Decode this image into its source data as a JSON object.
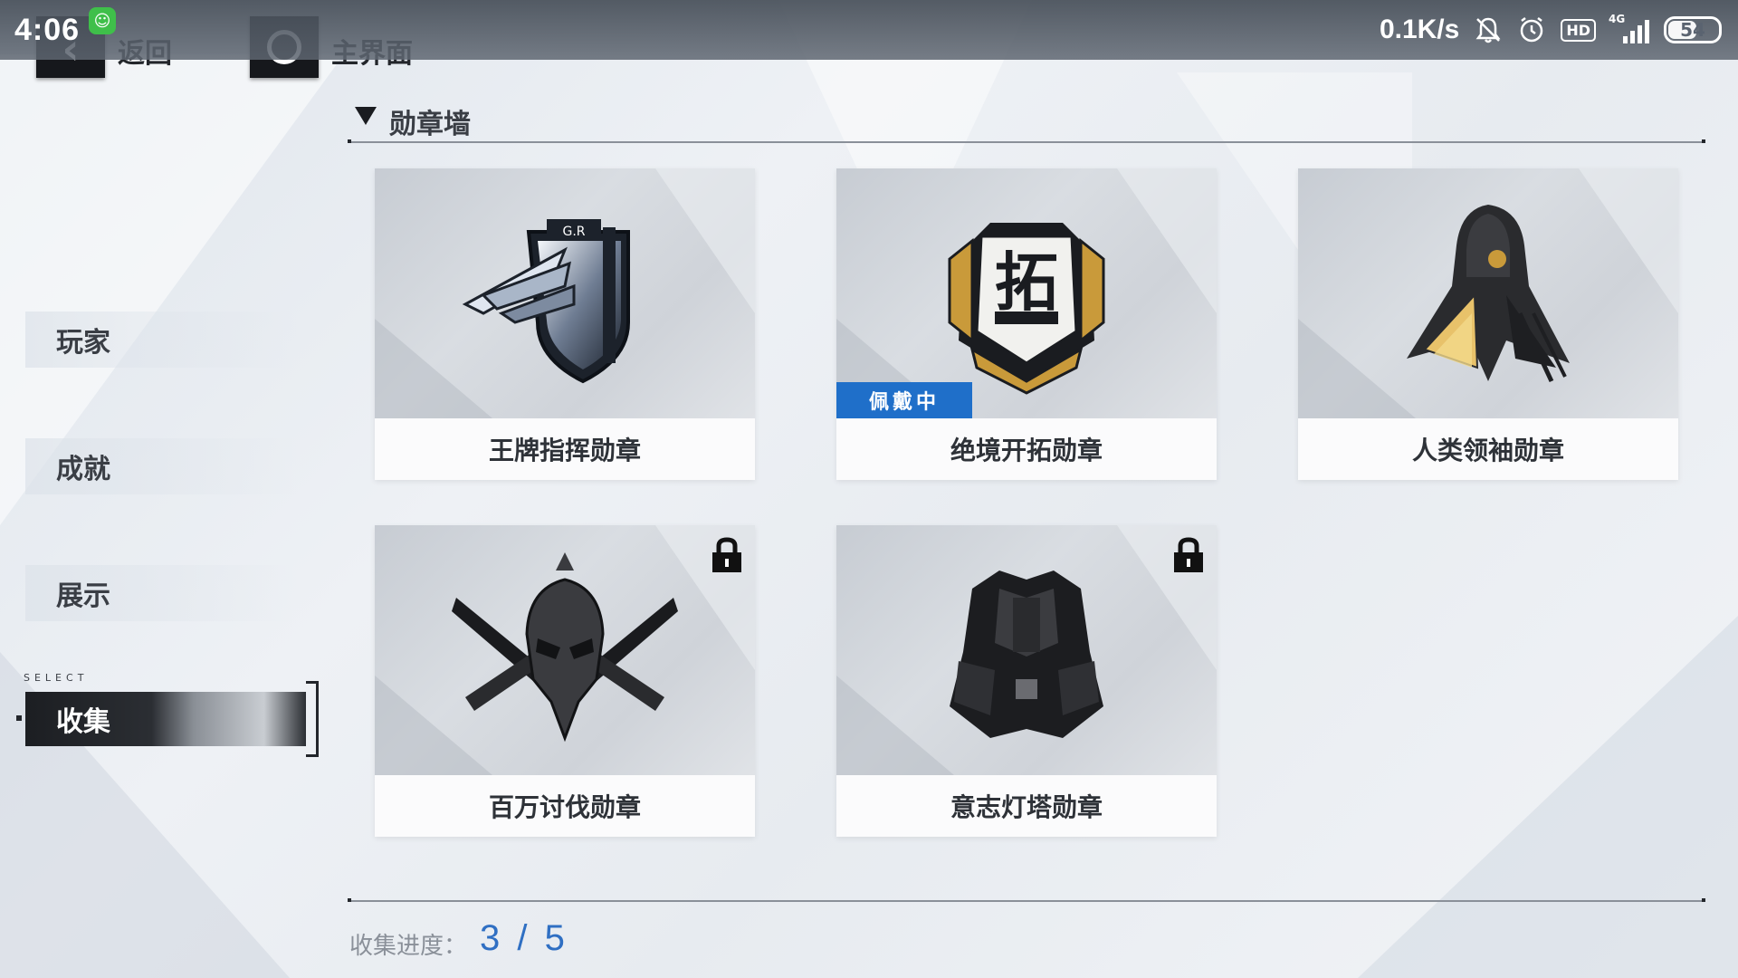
{
  "status_bar": {
    "time": "4:06",
    "net_speed": "0.1K/s",
    "hd_label": "HD",
    "network_label": "4G",
    "battery": "54",
    "battery_level": 0.54
  },
  "nav": {
    "back_label": "返回",
    "home_label": "主界面"
  },
  "sidebar": {
    "items": [
      {
        "label": "玩家"
      },
      {
        "label": "成就"
      },
      {
        "label": "展示"
      }
    ],
    "select_tag": "SELECT",
    "active": {
      "label": "收集"
    }
  },
  "section": {
    "title": "勋章墙"
  },
  "medals": [
    {
      "name": "王牌指挥勋章",
      "locked": false,
      "equipped": false,
      "icon": "wing-shield-medal-icon"
    },
    {
      "name": "绝境开拓勋章",
      "locked": false,
      "equipped": true,
      "equipped_label": "佩戴中",
      "icon": "gold-frame-medal-icon",
      "emblem_text": "拓"
    },
    {
      "name": "人类领袖勋章",
      "locked": false,
      "equipped": false,
      "icon": "hooded-leader-medal-icon"
    },
    {
      "name": "百万讨伐勋章",
      "locked": true,
      "equipped": false,
      "icon": "crossed-blades-skull-medal-icon"
    },
    {
      "name": "意志灯塔勋章",
      "locked": true,
      "equipped": false,
      "icon": "beacon-armor-medal-icon"
    }
  ],
  "progress": {
    "label": "收集进度：",
    "value": "3 / 5"
  },
  "colors": {
    "accent_blue": "#1f6fc9",
    "progress_blue": "#2f6fc3",
    "dark_button": "#16181c",
    "gold": "#c99a3a"
  }
}
